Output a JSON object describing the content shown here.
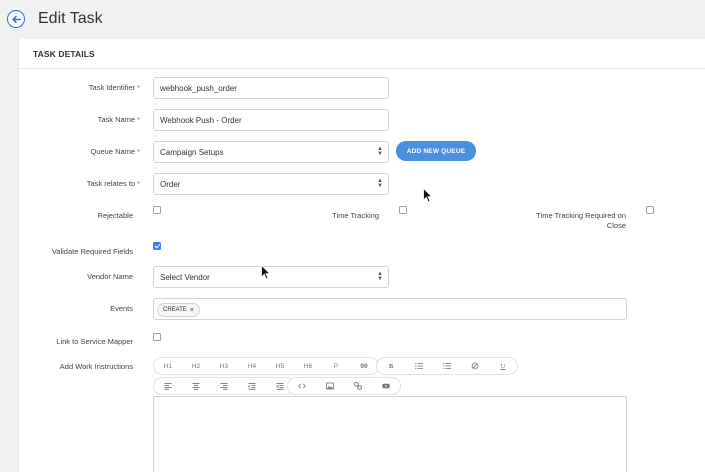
{
  "header": {
    "title": "Edit Task"
  },
  "section": {
    "title": "TASK DETAILS"
  },
  "form": {
    "task_identifier": {
      "label": "Task Identifier",
      "value": "webhook_push_order"
    },
    "task_name": {
      "label": "Task Name",
      "value": "Webhook Push - Order"
    },
    "queue_name": {
      "label": "Queue Name",
      "value": "Campaign Setups",
      "add_button": "ADD NEW QUEUE"
    },
    "task_relates_to": {
      "label": "Task relates to",
      "value": "Order"
    },
    "rejectable": {
      "label": "Rejectable",
      "checked": false
    },
    "time_tracking": {
      "label": "Time Tracking",
      "checked": false
    },
    "time_tracking_required_on_close": {
      "label_line1": "Time Tracking Required on",
      "label_line2": "Close",
      "checked": false
    },
    "validate_required_fields": {
      "label": "Validate Required Fields",
      "checked": true
    },
    "vendor_name": {
      "label": "Vendor Name",
      "placeholder": "Select Vendor"
    },
    "events": {
      "label": "Events",
      "tags": [
        "CREATE"
      ],
      "tag_remove": "×"
    },
    "link_to_service_mapper": {
      "label": "Link to Service Mapper",
      "checked": false
    },
    "work_instructions": {
      "label": "Add Work Instructions",
      "toolbar_row1_headings": [
        "H1",
        "H2",
        "H3",
        "H4",
        "H5",
        "H6",
        "P",
        "99"
      ],
      "toolbar_row1_format": [
        "B",
        "list-ul-icon",
        "list-ol-icon",
        "clear-icon",
        "U"
      ],
      "toolbar_row2_align": [
        "align-left-icon",
        "align-center-icon",
        "align-right-icon",
        "indent-icon",
        "outdent-icon"
      ],
      "toolbar_row2_insert": [
        "code-icon",
        "image-icon",
        "link-icon",
        "video-icon"
      ]
    }
  },
  "colors": {
    "accent": "#4a90e2",
    "required": "#d9534f",
    "background": "#f0f1f3"
  }
}
